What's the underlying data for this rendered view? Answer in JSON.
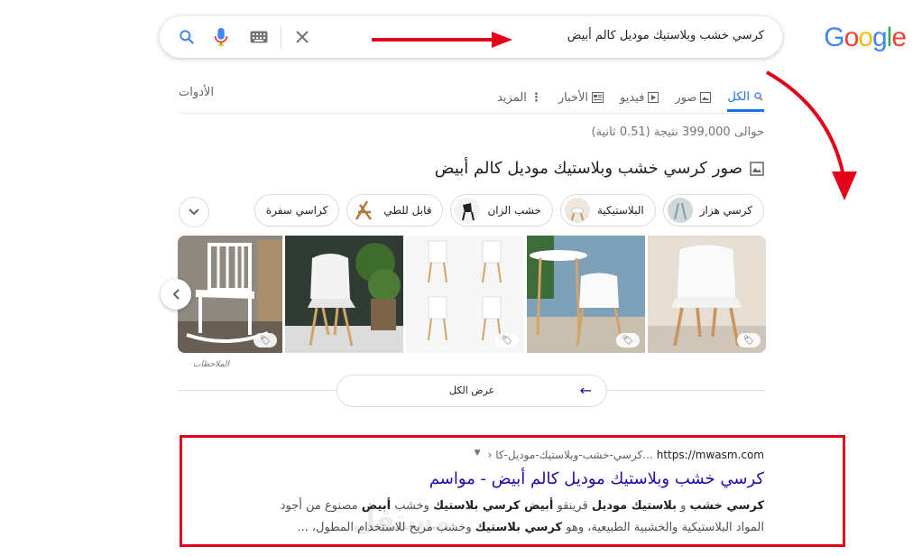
{
  "logo": "Google",
  "search": {
    "query": "كرسي خشب وبلاستيك موديل كالم أبيض"
  },
  "tabs": [
    {
      "label": "الكل",
      "icon": "search-icon"
    },
    {
      "label": "صور",
      "icon": "image-icon"
    },
    {
      "label": "فيديو",
      "icon": "video-icon"
    },
    {
      "label": "الأخبار",
      "icon": "news-icon"
    },
    {
      "label": "المزيد",
      "icon": "more-vert-icon"
    }
  ],
  "tools_label": "الأدوات",
  "stats": "حوالى 399,000 نتيجة (0.51 ثانية)",
  "images_heading": "صور كرسي خشب وبلاستيك موديل كالم أبيض",
  "chips": [
    {
      "label": "كرسي هزاز",
      "has_image": true
    },
    {
      "label": "البلاستيكية",
      "has_image": true
    },
    {
      "label": "خشب الزان",
      "has_image": true
    },
    {
      "label": "قابل للطي",
      "has_image": true
    },
    {
      "label": "كراسي سفرة",
      "has_image": false
    }
  ],
  "notes_label": "الملاحظات",
  "view_all_label": "عرض الكل",
  "result": {
    "url": "https://mwasm.com",
    "path": "› كرسي-خشب-وبلاستيك-موديل-كا...",
    "title": "كرسي خشب وبلاستيك موديل كالم أبيض - مواسم",
    "snippet_html": "<b>كرسي خشب</b> و <b>بلاستيك موديل</b> قرينقو <b>أبيض كرسي بلاستيك</b> وخشب <b>أبيض</b> مصنوع من أجود المواد البلاستيكية والخشبية الطبيعية، وهو <b>كرسي بلاستيك</b> وخشب مريح للاستخدام المطول، ..."
  },
  "watermark": "مستقل",
  "colors": {
    "accent": "#1a73e8",
    "link": "#1a0dab",
    "highlight_red": "#e2001a"
  }
}
